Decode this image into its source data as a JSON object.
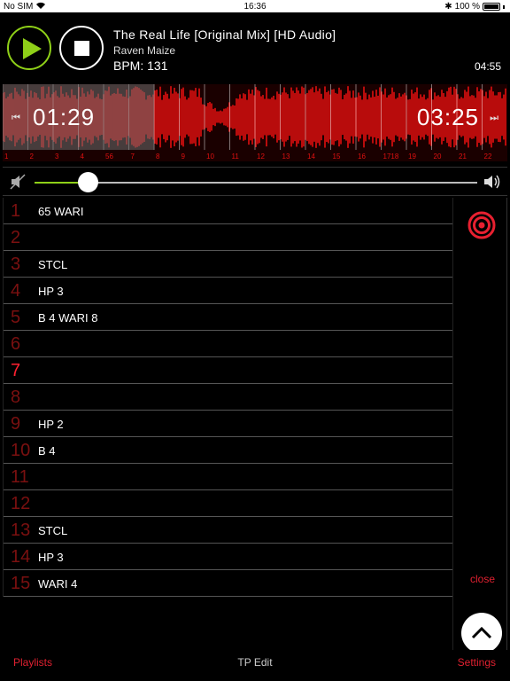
{
  "status_bar": {
    "carrier": "No SIM",
    "time": "16:36",
    "battery": "100 %"
  },
  "player": {
    "title": "The Real Life [Original Mix] [HD Audio]",
    "artist": "Raven Maize",
    "bpm": "BPM: 131",
    "duration": "04:55",
    "play_icon": "play-icon",
    "stop_icon": "stop-icon"
  },
  "waveform": {
    "elapsed": "01:29",
    "remaining": "03:25",
    "progress": 0.3,
    "markers": [
      "1",
      "2",
      "3",
      "4",
      "56",
      "7",
      "8",
      "9",
      "10",
      "11",
      "12",
      "13",
      "14",
      "15",
      "16",
      "1718",
      "19",
      "20",
      "21",
      "22",
      "23"
    ],
    "colors": {
      "wave": "#e01010",
      "background": "#1a0000"
    }
  },
  "volume": {
    "level": 0.12,
    "accent": "#8fd018"
  },
  "list": {
    "items": [
      {
        "num": "1",
        "label": "65 WARI",
        "active": false
      },
      {
        "num": "2",
        "label": "",
        "active": false
      },
      {
        "num": "3",
        "label": "STCL",
        "active": false
      },
      {
        "num": "4",
        "label": "HP 3",
        "active": false
      },
      {
        "num": "5",
        "label": "B 4 WARI 8",
        "active": false
      },
      {
        "num": "6",
        "label": "",
        "active": false
      },
      {
        "num": "7",
        "label": "",
        "active": true
      },
      {
        "num": "8",
        "label": "",
        "active": false
      },
      {
        "num": "9",
        "label": "HP 2",
        "active": false
      },
      {
        "num": "10",
        "label": "B 4",
        "active": false
      },
      {
        "num": "11",
        "label": "",
        "active": false
      },
      {
        "num": "12",
        "label": "",
        "active": false
      },
      {
        "num": "13",
        "label": "STCL",
        "active": false
      },
      {
        "num": "14",
        "label": "HP 3",
        "active": false
      },
      {
        "num": "15",
        "label": "WARI 4",
        "active": false
      }
    ]
  },
  "side": {
    "close_label": "close"
  },
  "bottom_bar": {
    "playlists": "Playlists",
    "tp_edit": "TP Edit",
    "settings": "Settings"
  }
}
